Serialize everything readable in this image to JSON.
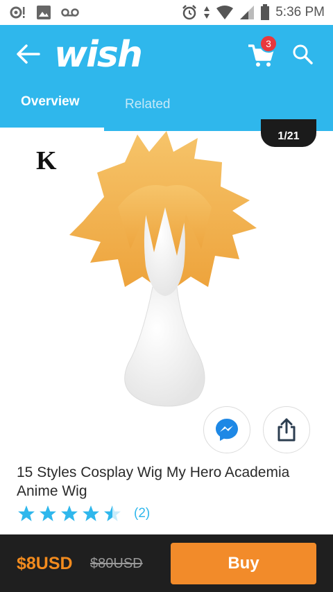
{
  "status_bar": {
    "time": "5:36 PM",
    "icons": [
      "notification-icon",
      "image-icon",
      "voicemail-icon",
      "alarm-icon",
      "data-arrows-icon",
      "wifi-icon",
      "signal-icon",
      "battery-icon"
    ]
  },
  "header": {
    "logo_text": "wish",
    "cart_count": "3",
    "icons": [
      "back-arrow-icon",
      "cart-icon",
      "search-icon"
    ]
  },
  "tabs": [
    {
      "label": "Overview",
      "active": true
    },
    {
      "label": "Related",
      "active": false
    }
  ],
  "gallery": {
    "counter": "1/21",
    "brand_mark": "K"
  },
  "product": {
    "title": "15 Styles Cosplay Wig My Hero Academia Anime Wig",
    "rating_stars": 4.5,
    "review_count": "(2)"
  },
  "footer": {
    "price": "$8USD",
    "original_price": "$80USD",
    "buy_label": "Buy"
  },
  "colors": {
    "brand_blue": "#2fb7ec",
    "accent_orange": "#f28b2a",
    "badge_red": "#e8383d",
    "footer_dark": "#1f1f1f"
  }
}
